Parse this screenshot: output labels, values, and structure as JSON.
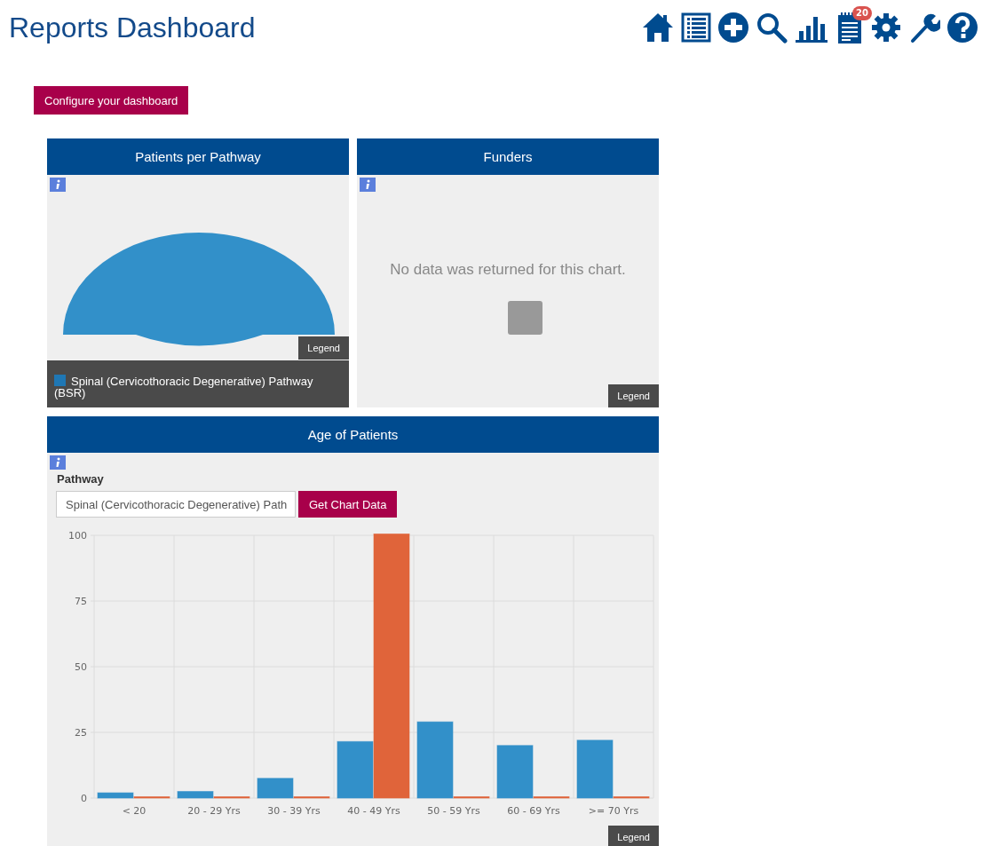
{
  "header": {
    "title": "Reports Dashboard",
    "toolbar": [
      {
        "kind": "home"
      },
      {
        "kind": "list"
      },
      {
        "kind": "add"
      },
      {
        "kind": "search"
      },
      {
        "kind": "chart"
      },
      {
        "kind": "notes",
        "badge": "20"
      },
      {
        "kind": "settings"
      },
      {
        "kind": "tools"
      },
      {
        "kind": "help"
      }
    ]
  },
  "configure_button": "Configure your dashboard",
  "panels": [
    {
      "kind": "pie",
      "title": "Patients per Pathway",
      "legend_label": "Legend",
      "legend_items": [
        {
          "label": "Spinal (Cervicothoracic Degenerative) Pathway (BSR)",
          "color": "#1f77b4"
        }
      ]
    },
    {
      "kind": "empty",
      "title": "Funders",
      "message": "No data was returned for this chart.",
      "legend_label": "Legend"
    }
  ],
  "age_panel": {
    "title": "Age of Patients",
    "filter_label": "Pathway",
    "filter_value": "Spinal (Cervicothoracic Degenerative) Path",
    "button": "Get Chart Data",
    "legend_label": "Legend",
    "chart_data": {
      "type": "bar",
      "grid": true,
      "categories": [
        "< 20",
        "20 - 29 Yrs",
        "30 - 39 Yrs",
        "40 - 49 Yrs",
        "50 - 59 Yrs",
        "60 - 69 Yrs",
        ">= 70 Yrs"
      ],
      "ylim": [
        0,
        100
      ],
      "yticks": [
        0,
        25,
        50,
        75,
        100
      ],
      "series": [
        {
          "color": "#3290c9",
          "values": [
            1.5,
            2,
            7,
            21,
            28.5,
            19.5,
            21.5
          ]
        },
        {
          "color": "#e0643a",
          "values": [
            0,
            0,
            0,
            100,
            0,
            0,
            0
          ]
        }
      ]
    }
  }
}
